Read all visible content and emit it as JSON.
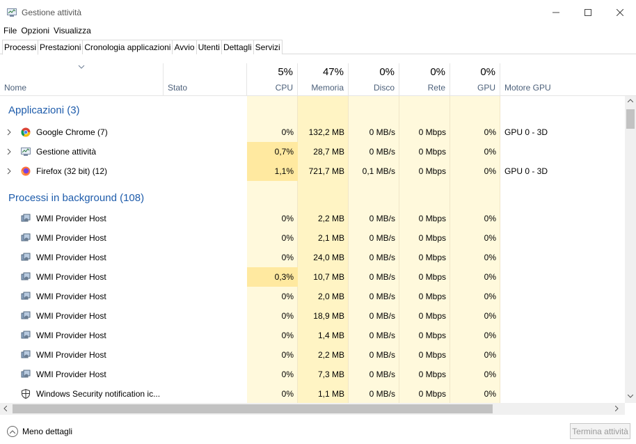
{
  "window": {
    "title": "Gestione attività"
  },
  "menu": [
    "File",
    "Opzioni",
    "Visualizza"
  ],
  "tabs": [
    "Processi",
    "Prestazioni",
    "Cronologia applicazioni",
    "Avvio",
    "Utenti",
    "Dettagli",
    "Servizi"
  ],
  "active_tab": "Processi",
  "columns": {
    "name": "Nome",
    "status": "Stato",
    "cpu": {
      "pct": "5%",
      "label": "CPU"
    },
    "memory": {
      "pct": "47%",
      "label": "Memoria"
    },
    "disk": {
      "pct": "0%",
      "label": "Disco"
    },
    "network": {
      "pct": "0%",
      "label": "Rete"
    },
    "gpu": {
      "pct": "0%",
      "label": "GPU"
    },
    "gpu_engine": "Motore GPU"
  },
  "groups": {
    "apps": "Applicazioni (3)",
    "background": "Processi in background (108)"
  },
  "apps": [
    {
      "name": "Google Chrome (7)",
      "icon": "chrome-icon",
      "cpu": "0%",
      "mem": "132,2 MB",
      "disk": "0 MB/s",
      "net": "0 Mbps",
      "gpu": "0%",
      "engine": "GPU 0 - 3D"
    },
    {
      "name": "Gestione attività",
      "icon": "task-manager-icon",
      "cpu": "0,7%",
      "mem": "28,7 MB",
      "disk": "0 MB/s",
      "net": "0 Mbps",
      "gpu": "0%",
      "engine": ""
    },
    {
      "name": "Firefox (32 bit) (12)",
      "icon": "firefox-icon",
      "cpu": "1,1%",
      "mem": "721,7 MB",
      "disk": "0,1 MB/s",
      "net": "0 Mbps",
      "gpu": "0%",
      "engine": "GPU 0 - 3D"
    }
  ],
  "background": [
    {
      "name": "WMI Provider Host",
      "icon": "service-host-icon",
      "cpu": "0%",
      "mem": "2,2 MB",
      "disk": "0 MB/s",
      "net": "0 Mbps",
      "gpu": "0%"
    },
    {
      "name": "WMI Provider Host",
      "icon": "service-host-icon",
      "cpu": "0%",
      "mem": "2,1 MB",
      "disk": "0 MB/s",
      "net": "0 Mbps",
      "gpu": "0%"
    },
    {
      "name": "WMI Provider Host",
      "icon": "service-host-icon",
      "cpu": "0%",
      "mem": "24,0 MB",
      "disk": "0 MB/s",
      "net": "0 Mbps",
      "gpu": "0%"
    },
    {
      "name": "WMI Provider Host",
      "icon": "service-host-icon",
      "cpu": "0,3%",
      "mem": "10,7 MB",
      "disk": "0 MB/s",
      "net": "0 Mbps",
      "gpu": "0%"
    },
    {
      "name": "WMI Provider Host",
      "icon": "service-host-icon",
      "cpu": "0%",
      "mem": "2,0 MB",
      "disk": "0 MB/s",
      "net": "0 Mbps",
      "gpu": "0%"
    },
    {
      "name": "WMI Provider Host",
      "icon": "service-host-icon",
      "cpu": "0%",
      "mem": "18,9 MB",
      "disk": "0 MB/s",
      "net": "0 Mbps",
      "gpu": "0%"
    },
    {
      "name": "WMI Provider Host",
      "icon": "service-host-icon",
      "cpu": "0%",
      "mem": "1,4 MB",
      "disk": "0 MB/s",
      "net": "0 Mbps",
      "gpu": "0%"
    },
    {
      "name": "WMI Provider Host",
      "icon": "service-host-icon",
      "cpu": "0%",
      "mem": "2,2 MB",
      "disk": "0 MB/s",
      "net": "0 Mbps",
      "gpu": "0%"
    },
    {
      "name": "WMI Provider Host",
      "icon": "service-host-icon",
      "cpu": "0%",
      "mem": "7,3 MB",
      "disk": "0 MB/s",
      "net": "0 Mbps",
      "gpu": "0%"
    },
    {
      "name": "Windows Security notification ic...",
      "icon": "shield-icon",
      "cpu": "0%",
      "mem": "1,1 MB",
      "disk": "0 MB/s",
      "net": "0 Mbps",
      "gpu": "0%"
    }
  ],
  "footer": {
    "less_details": "Meno dettagli",
    "end_task": "Termina attività"
  },
  "colors": {
    "heat_light": "#fff4c4",
    "heat_medium": "#ffe9a0",
    "group_title": "#1e5cab",
    "header_label": "#4c607a"
  }
}
